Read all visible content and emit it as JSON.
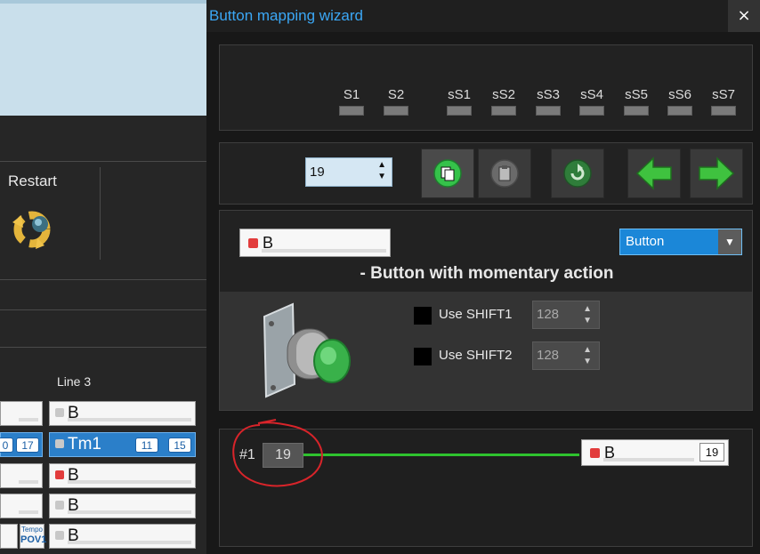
{
  "background_app": {
    "restart_label": "Restart",
    "column_label": "Line 3",
    "cells": [
      {
        "text": "B",
        "indicator": "gray"
      },
      {
        "text": "Tm1",
        "indicator": "gray",
        "badges": [
          "11",
          "15"
        ],
        "left_badges": [
          "0",
          "17"
        ]
      },
      {
        "text": "B",
        "indicator": "red"
      },
      {
        "text": "B",
        "indicator": "gray"
      },
      {
        "text": "B",
        "indicator": "gray"
      }
    ],
    "tempo_top": "Tempo",
    "tempo_bottom": "POV1"
  },
  "dialog": {
    "title": "Button mapping wizard",
    "close_glyph": "×",
    "leds": [
      "S1",
      "S2",
      "sS1",
      "sS2",
      "sS3",
      "sS4",
      "sS5",
      "sS6",
      "sS7"
    ],
    "button_number": "19",
    "spin_glyph": "▲▼",
    "toolbar": [
      "copy-icon",
      "paste-icon",
      "reset-icon",
      "arrow-left-icon",
      "arrow-right-icon"
    ],
    "button_name": "B",
    "type_select_value": "Button",
    "type_description": "- Button with momentary action",
    "shift1_label": "Use SHIFT1",
    "shift1_value": "128",
    "shift2_label": "Use SHIFT2",
    "shift2_value": "128",
    "mapping": {
      "index_label": "#1",
      "source_number": "19",
      "target_name": "B",
      "target_number": "19"
    }
  },
  "colors": {
    "accent": "#3ba7f5",
    "active_line": "#2ec22e",
    "indicator_red": "#e23c3c",
    "select_blue": "#1b87d8"
  }
}
